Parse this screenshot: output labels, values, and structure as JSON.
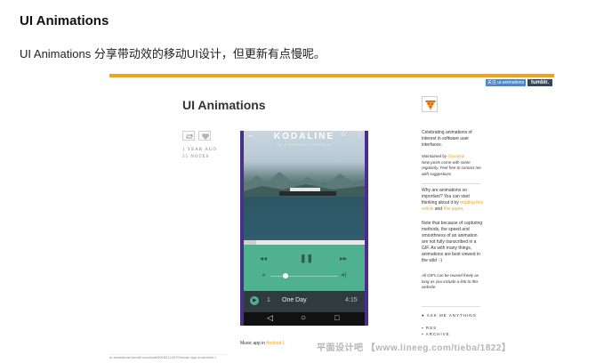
{
  "article": {
    "title": "UI Animations",
    "description": "UI Animations 分享带动效的移动UI设计，但更新有点慢呢。"
  },
  "tumblr_header": {
    "follow_label": "关注 ui-animations",
    "tumblr_label": "tumblr.",
    "accent_color": "#f4a01c"
  },
  "blog": {
    "title": "UI Animations",
    "post_date": "1 YEAR AGO",
    "post_notes": "55 NOTES"
  },
  "player": {
    "band": "KODALINE",
    "album": "IN A PERFECT WORLD",
    "track_number": "1",
    "track_name": "One Day",
    "track_time": "4:15",
    "progress_fraction": 0.1,
    "volume_fraction": 0.23,
    "accent_color": "#4fb18f"
  },
  "post": {
    "caption_prefix": "Music app in ",
    "caption_link": "Android L",
    "url": "ui-animations.tumblr.com/post/90182124370/music-app-in-android-l"
  },
  "sidebar": {
    "about": "Celebrating animations of interest in software user interfaces.",
    "maintained_by": "Maintained by ",
    "maintainer": "@jordisol",
    "new_posts": "New posts come with some regularity. Feel free to contact me with suggestions",
    "why_text": "Why are animations so important? You can start thinking about it by ",
    "why_link1": "reading this article",
    "why_and": " and ",
    "why_link2": "this paper",
    "why_end": ".",
    "note": "Note that because of capturing methods, the speed and smoothness of an animation are not fully transcribed in a GIF. As with many things, animations are best viewed in the wild :-)",
    "gifs": "All GIFs can be reused freely as long as you include a link to this website.",
    "ask": "ASK ME ANYTHING",
    "rss": "RSS",
    "archive": "ARCHIVE"
  },
  "watermark": "平面设计吧 【www.lineeg.com/tieba/1822】"
}
